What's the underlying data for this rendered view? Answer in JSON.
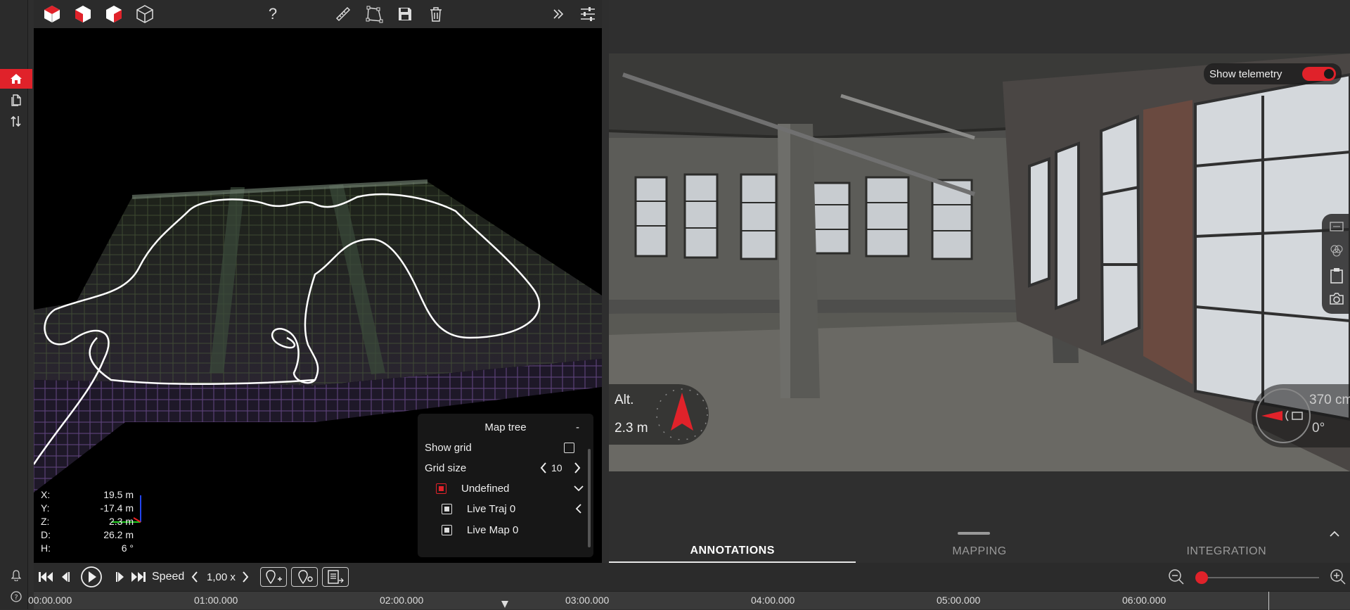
{
  "toolbar": {
    "help_label": "?"
  },
  "sidebar": {
    "items": [
      "home-icon",
      "document-icon",
      "sort-arrows-icon"
    ]
  },
  "viewer3d": {
    "coords": [
      {
        "k": "X:",
        "v": "19.5 m"
      },
      {
        "k": "Y:",
        "v": "-17.4 m"
      },
      {
        "k": "Z:",
        "v": "2.3 m"
      },
      {
        "k": "D:",
        "v": "26.2 m"
      },
      {
        "k": "H:",
        "v": "6 °"
      }
    ]
  },
  "maptree": {
    "title": "Map tree",
    "collapse": "-",
    "show_grid_label": "Show grid",
    "grid_size_label": "Grid size",
    "grid_size_value": "10",
    "group_label": "Undefined",
    "items": [
      "Live Traj 0",
      "Live Map 0"
    ]
  },
  "video": {
    "telemetry_label": "Show telemetry",
    "alt_label": "Alt.",
    "alt_value": "2.3 m",
    "dist_value": "370 cm",
    "angle_value": "0°"
  },
  "tabs": [
    "ANNOTATIONS",
    "MAPPING",
    "INTEGRATION"
  ],
  "playbar": {
    "speed_label": "Speed",
    "speed_value": "1,00 x"
  },
  "timeline": {
    "labels": [
      "00:00.000",
      "01:00.000",
      "02:00.000",
      "03:00.000",
      "04:00.000",
      "05:00.000",
      "06:00.000"
    ]
  },
  "colors": {
    "accent": "#e0222a",
    "background": "#2e2e2e"
  }
}
